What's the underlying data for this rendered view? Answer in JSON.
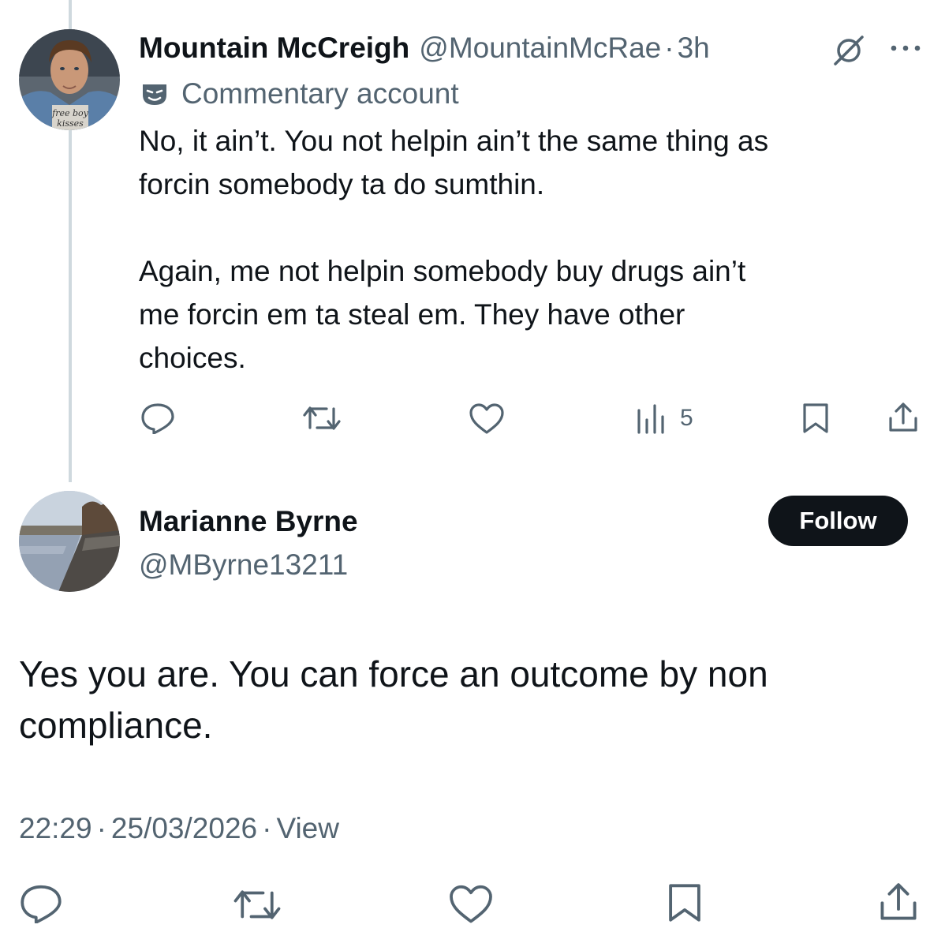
{
  "reply_tweet": {
    "author_name": "Mountain McCreigh",
    "handle": "@MountainMcRae",
    "separator": "·",
    "time": "3h",
    "label": "Commentary account",
    "avatar_text_1": "free boy",
    "avatar_text_2": "kisses",
    "paragraph1_line1": "No, it ain’t. You not helpin ain’t the same thing as",
    "paragraph1_line2": "forcin somebody ta do sumthin.",
    "paragraph2_line1": "Again, me not helpin somebody buy drugs ain’t",
    "paragraph2_line2": "me forcin em ta steal em. They have other",
    "paragraph2_line3": "choices.",
    "views": "5",
    "icons": [
      "reply-icon",
      "retweet-icon",
      "like-icon",
      "views-icon",
      "bookmark-icon",
      "share-icon"
    ]
  },
  "main_tweet": {
    "author_name": "Marianne Byrne",
    "handle": "@MByrne13211",
    "follow_label": "Follow",
    "text_line1": "Yes you are. You can force an outcome by non",
    "text_line2": "compliance.",
    "time": "22:29",
    "dot": "·",
    "date": "25/03/2026",
    "view_label": "View",
    "icons": [
      "reply-icon",
      "retweet-icon",
      "like-icon",
      "bookmark-icon",
      "share-icon"
    ]
  },
  "colors": {
    "text": "#0f1419",
    "muted": "#536471",
    "thread_line": "#cfd9de",
    "follow_bg": "#0f1419"
  }
}
